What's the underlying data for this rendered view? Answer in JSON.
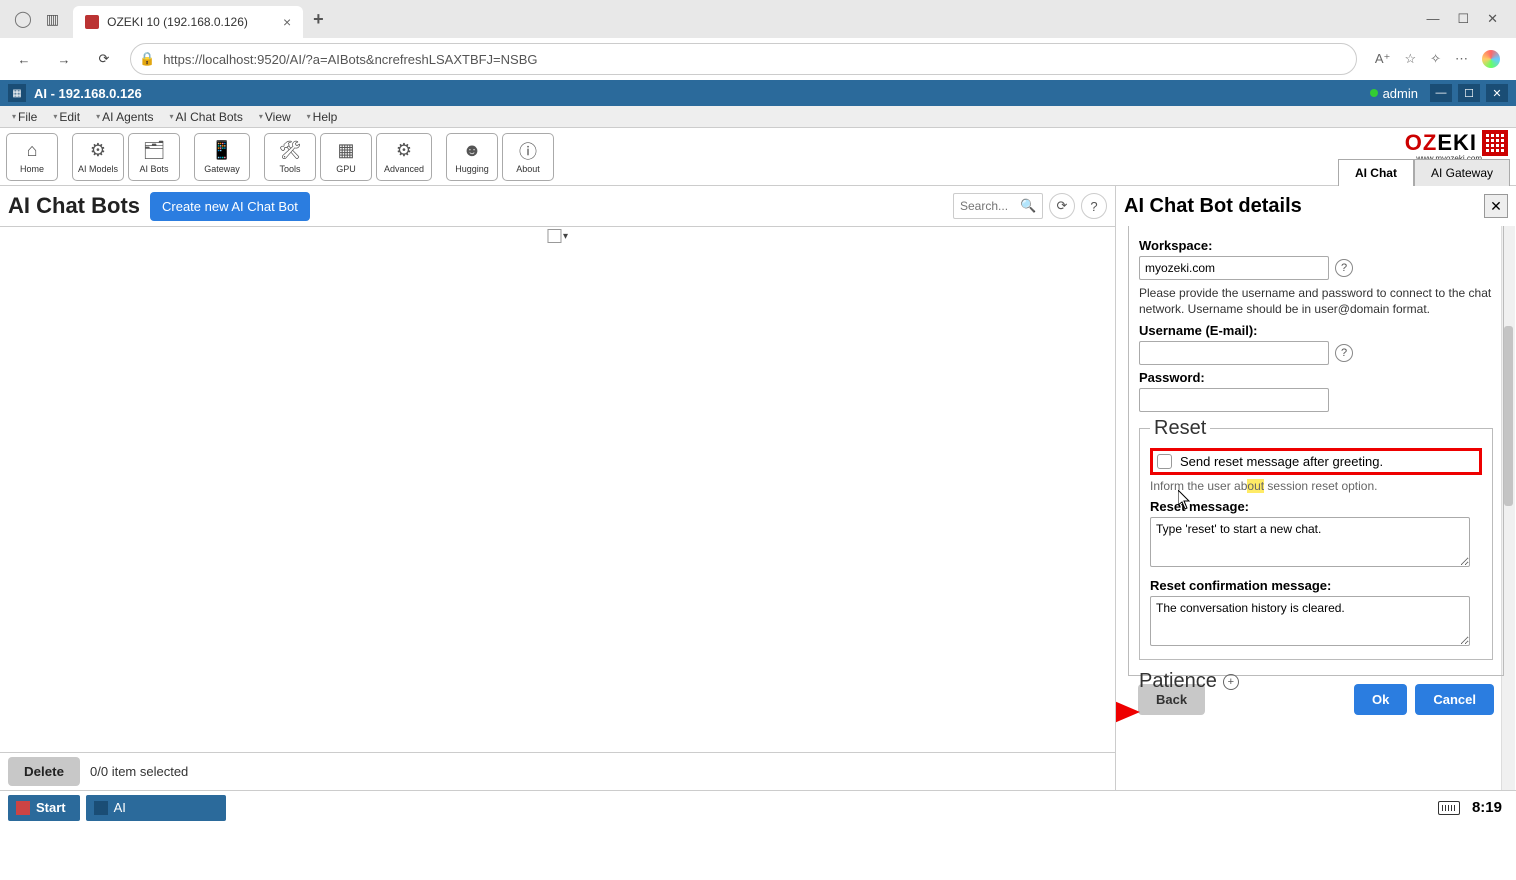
{
  "browser": {
    "tab_title": "OZEKI 10 (192.168.0.126)",
    "url": "https://localhost:9520/AI/?a=AIBots&ncrefreshLSAXTBFJ=NSBG"
  },
  "app": {
    "title": "AI - 192.168.0.126",
    "user": "admin"
  },
  "menu": {
    "items": [
      "File",
      "Edit",
      "AI Agents",
      "AI Chat Bots",
      "View",
      "Help"
    ]
  },
  "toolbar": {
    "buttons": [
      {
        "label": "Home",
        "icon": "⌂"
      },
      {
        "label": "AI Models",
        "icon": "⚙"
      },
      {
        "label": "AI Bots",
        "icon": "🗂"
      },
      {
        "label": "Gateway",
        "icon": "📱"
      },
      {
        "label": "Tools",
        "icon": "🛠"
      },
      {
        "label": "GPU",
        "icon": "▦"
      },
      {
        "label": "Advanced",
        "icon": "⚙"
      },
      {
        "label": "Hugging",
        "icon": "☻"
      },
      {
        "label": "About",
        "icon": "ⓘ"
      }
    ],
    "right_tabs": [
      "AI Chat",
      "AI Gateway"
    ]
  },
  "logo": {
    "brand1": "OZ",
    "brand2": "EKI",
    "sub": "www.myozeki.com"
  },
  "left": {
    "title": "AI Chat Bots",
    "create_label": "Create new AI Chat Bot",
    "search_placeholder": "Search...",
    "delete_label": "Delete",
    "selection_text": "0/0 item selected"
  },
  "details": {
    "title": "AI Chat Bot details",
    "workspace_label": "Workspace:",
    "workspace_value": "myozeki.com",
    "help_text": "Please provide the username and password to connect to the chat network. Username should be in user@domain format.",
    "username_label": "Username (E-mail):",
    "username_value": "",
    "password_label": "Password:",
    "password_value": "",
    "reset_title": "Reset",
    "reset_checkbox_label": "Send reset message after greeting.",
    "reset_subtext_a": "Inform the user ab",
    "reset_subtext_b": "out",
    "reset_subtext_c": " session reset option.",
    "reset_msg_label": "Reset message:",
    "reset_msg_value": "Type 'reset' to start a new chat.",
    "reset_conf_label": "Reset confirmation message:",
    "reset_conf_value": "The conversation history is cleared.",
    "patience_title": "Patience",
    "back_label": "Back",
    "ok_label": "Ok",
    "cancel_label": "Cancel"
  },
  "taskbar": {
    "start": "Start",
    "task": "AI",
    "time": "8:19"
  }
}
